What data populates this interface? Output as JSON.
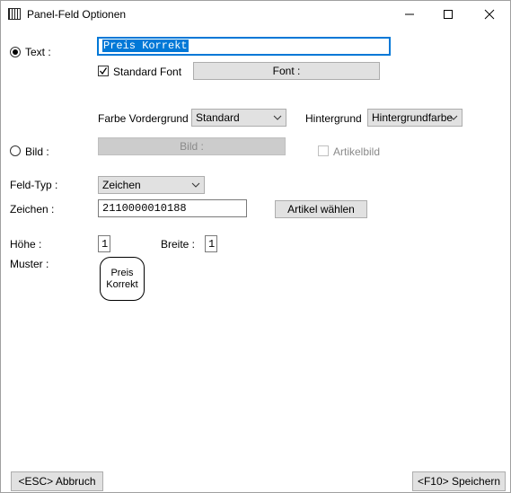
{
  "window": {
    "title": "Panel-Feld Optionen"
  },
  "text_option": {
    "label": "Text :",
    "selected": true,
    "value": "Preis Korrekt"
  },
  "standard_font": {
    "label": "Standard Font",
    "checked": true
  },
  "font_button": "Font :",
  "foreground": {
    "label": "Farbe Vordergrund",
    "value": "Standard"
  },
  "background": {
    "label": "Hintergrund",
    "value": "Hintergrundfarbe"
  },
  "image_option": {
    "label": "Bild :",
    "selected": false
  },
  "image_button": "Bild :",
  "article_image": {
    "label": "Artikelbild",
    "checked": false
  },
  "field_type": {
    "label": "Feld-Typ :",
    "value": "Zeichen"
  },
  "chars": {
    "label": "Zeichen :",
    "value": "2110000010188"
  },
  "select_article_button": "Artikel wählen",
  "height": {
    "label": "Höhe :",
    "value": "1"
  },
  "width": {
    "label": "Breite :",
    "value": "1"
  },
  "pattern": {
    "label": "Muster :",
    "line1": "Preis",
    "line2": "Korrekt"
  },
  "cancel_button": "<ESC> Abbruch",
  "save_button": "<F10> Speichern"
}
